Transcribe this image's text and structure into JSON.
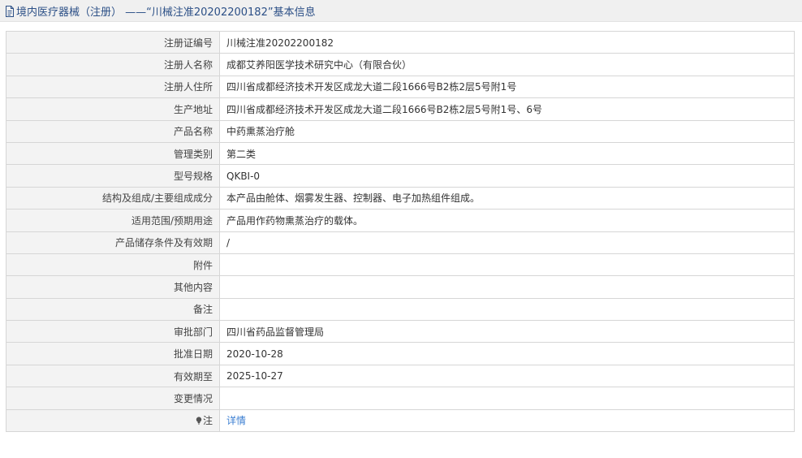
{
  "header": {
    "title": "境内医疗器械（注册） ——“川械注准20202200182”基本信息"
  },
  "rows": [
    {
      "label": "注册证编号",
      "value": "川械注准20202200182"
    },
    {
      "label": "注册人名称",
      "value": "成都艾养阳医学技术研究中心（有限合伙）"
    },
    {
      "label": "注册人住所",
      "value": "四川省成都经济技术开发区成龙大道二段1666号B2栋2层5号附1号"
    },
    {
      "label": "生产地址",
      "value": "四川省成都经济技术开发区成龙大道二段1666号B2栋2层5号附1号、6号"
    },
    {
      "label": "产品名称",
      "value": "中药熏蒸治疗舱"
    },
    {
      "label": "管理类别",
      "value": "第二类"
    },
    {
      "label": "型号规格",
      "value": "QKBI-0"
    },
    {
      "label": "结构及组成/主要组成成分",
      "value": "本产品由舱体、烟雾发生器、控制器、电子加热组件组成。"
    },
    {
      "label": "适用范围/预期用途",
      "value": "产品用作药物熏蒸治疗的载体。"
    },
    {
      "label": "产品储存条件及有效期",
      "value": "/"
    },
    {
      "label": "附件",
      "value": ""
    },
    {
      "label": "其他内容",
      "value": ""
    },
    {
      "label": "备注",
      "value": ""
    },
    {
      "label": "审批部门",
      "value": "四川省药品监督管理局"
    },
    {
      "label": "批准日期",
      "value": "2020-10-28"
    },
    {
      "label": "有效期至",
      "value": "2025-10-27"
    },
    {
      "label": "变更情况",
      "value": ""
    }
  ],
  "note": {
    "label": "注",
    "link_text": "详情",
    "icon": "lightbulb-icon"
  },
  "colors": {
    "header_text": "#2b4f86",
    "link": "#3a7ed2",
    "label_bg": "#f3f3f3",
    "border": "#d6d6d6"
  }
}
